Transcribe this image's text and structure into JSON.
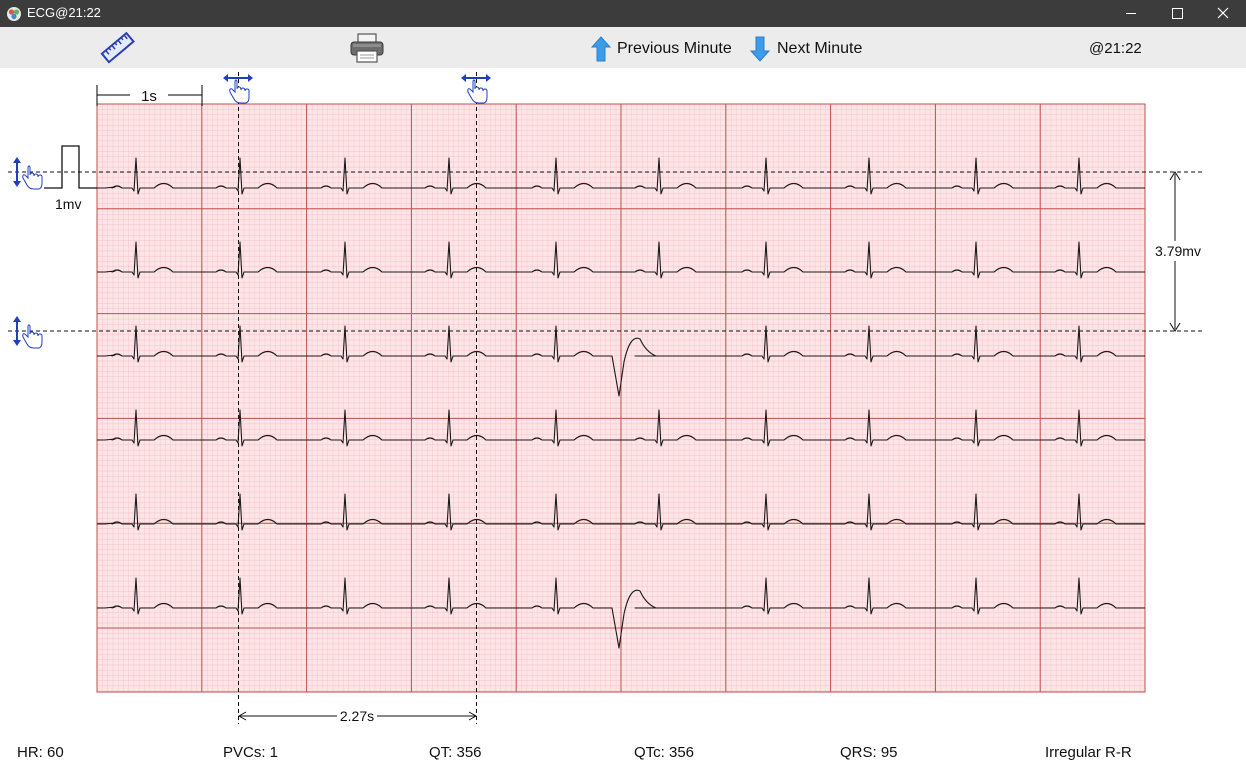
{
  "window": {
    "title": "ECG@21:22"
  },
  "toolbar": {
    "ruler_icon": "ruler-icon",
    "print_icon": "printer-icon",
    "previous_label": "Previous Minute",
    "next_label": "Next Minute",
    "time_label": "@21:22"
  },
  "ecg": {
    "time_scale_label": "1s",
    "calibration_label": "1mv",
    "amplitude_measure_label": "3.79mv",
    "interval_measure_label": "2.27s",
    "grid_major_color": "#c0504d",
    "grid_minor_color": "#f3b8bc",
    "grid_background": "#fde4e6",
    "trace_color": "#1a1a1a",
    "caliper_color": "#1f3fbf",
    "strip_count": 6,
    "beats_per_strip": 10,
    "pvc_strips": [
      3,
      6
    ]
  },
  "stats": {
    "hr": "HR: 60",
    "pvcs": "PVCs: 1",
    "qt": "QT: 356",
    "qtc": "QTc: 356",
    "qrs": "QRS: 95",
    "rhythm": "Irregular R-R"
  }
}
